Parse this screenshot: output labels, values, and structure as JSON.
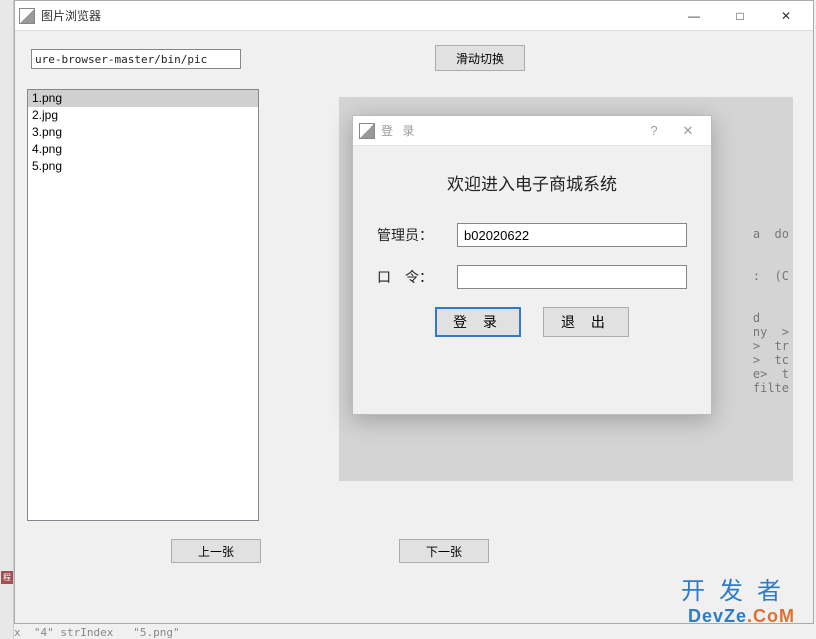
{
  "window": {
    "title": "图片浏览器",
    "minimize_glyph": "—",
    "maximize_glyph": "□",
    "close_glyph": "✕"
  },
  "path_input_value": "ure-browser-master/bin/pic",
  "slide_switch_label": "滑动切换",
  "file_list": {
    "items": [
      "1.png",
      "2.jpg",
      "3.png",
      "4.png",
      "5.png"
    ],
    "selected_index": 0
  },
  "nav": {
    "prev_label": "上一张",
    "next_label": "下一张"
  },
  "bg_frag": "a  do\n\n\n:  (C\n\n\nd\nny  >\n>  tr\n>  tc\ne>  t\nfilte",
  "login": {
    "dialog_title": "登 录",
    "help_glyph": "?",
    "close_glyph": "✕",
    "welcome_text": "欢迎进入电子商城系统",
    "admin_label": "管理员：",
    "admin_value": "b02020622",
    "password_label": "口　令：",
    "password_value": "",
    "login_btn": "登 录",
    "exit_btn": "退 出"
  },
  "watermark": {
    "cn": "开发者",
    "en_parts": [
      "D",
      "ev",
      "Z",
      "e",
      ".",
      "C",
      "o",
      "M"
    ]
  },
  "left_marker": "程",
  "bottom_text": "x  \"4\" strIndex   \"5.png\""
}
